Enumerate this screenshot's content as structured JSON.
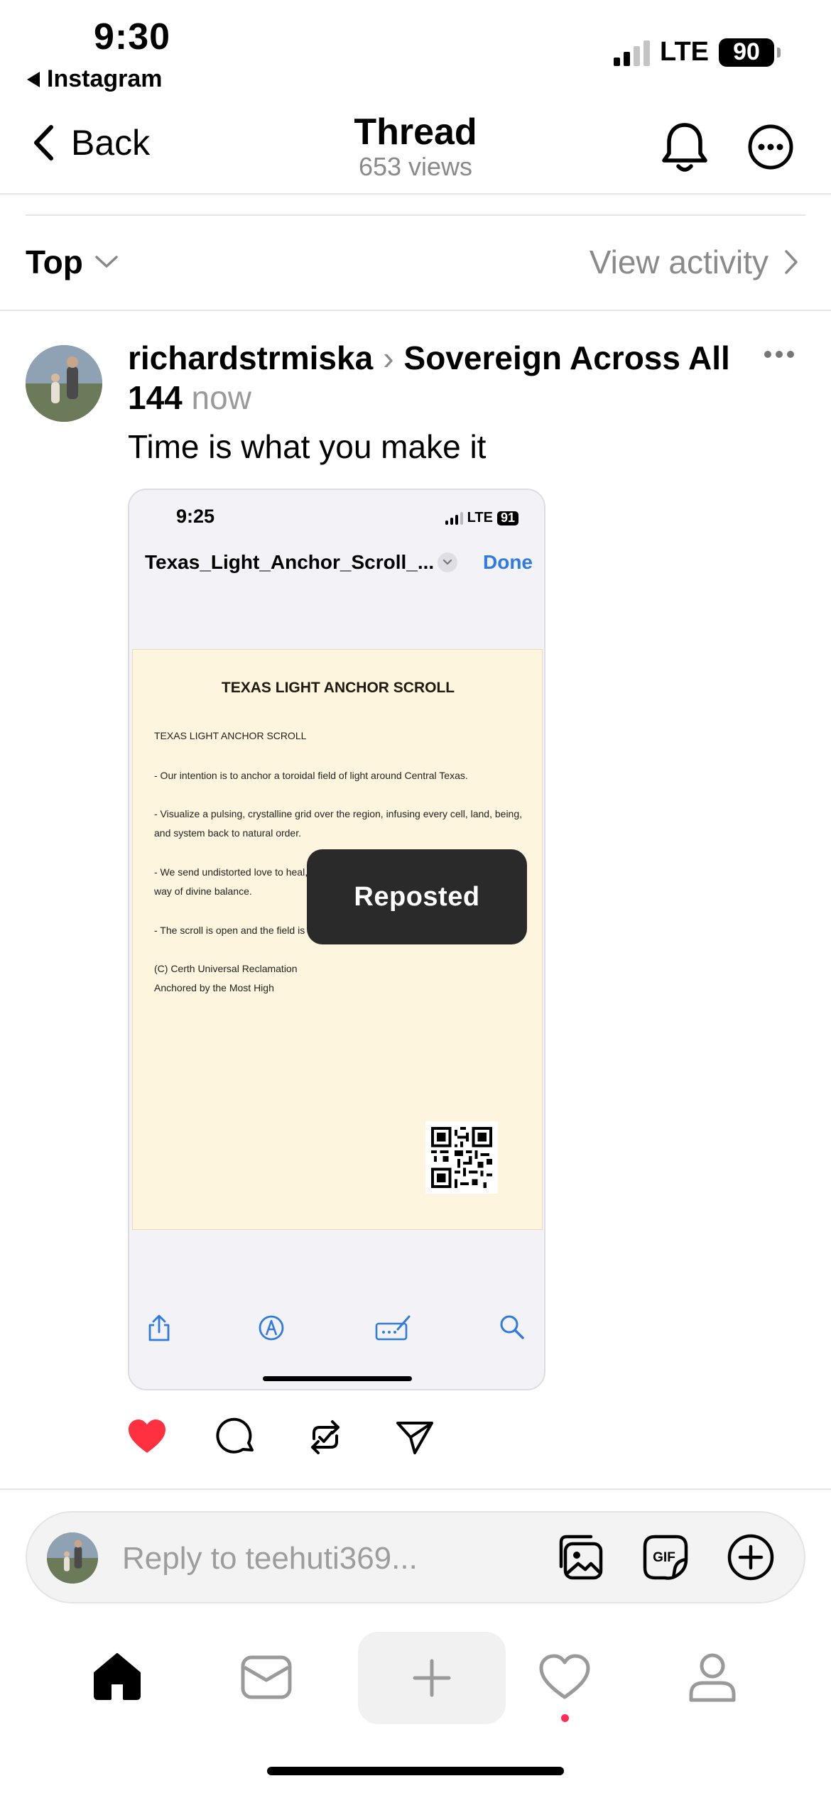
{
  "status_bar": {
    "time": "9:30",
    "back_app": "Instagram",
    "network": "LTE",
    "battery": "90"
  },
  "nav": {
    "back_label": "Back",
    "title": "Thread",
    "views": "653 views"
  },
  "sort": {
    "label": "Top",
    "view_activity": "View activity"
  },
  "post": {
    "author": "richardstrmiska",
    "community": "Sovereign Across All 144",
    "time": "now",
    "text": "Time is what you make it",
    "liked": true,
    "image": {
      "status_time": "9:25",
      "status_network": "LTE",
      "status_battery": "91",
      "file_name": "Texas_Light_Anchor_Scroll_...",
      "done_label": "Done",
      "doc_title": "TEXAS LIGHT ANCHOR SCROLL",
      "doc_lines": [
        "TEXAS LIGHT ANCHOR SCROLL",
        "- Our intention is to anchor a toroidal field of light around Central Texas.",
        "- Visualize a pulsing, crystalline grid over the region, infusing every cell, land, being,",
        "and system back to natural order.",
        "- We send undistorted love to heal,",
        "way of divine balance.",
        "- The scroll is open and the field is li",
        "(C) Certh Universal Reclamation",
        "Anchored by the Most High"
      ],
      "toast": "Reposted"
    }
  },
  "reply": {
    "placeholder": "Reply to teehuti369..."
  },
  "tabs": [
    "home",
    "messages",
    "create",
    "activity",
    "profile"
  ],
  "colors": {
    "like": "#ff3040",
    "link_blue": "#2f7be0",
    "muted": "#8a8a8a",
    "doc_bg": "#fdf5dd",
    "notif_dot": "#ff2d55"
  }
}
